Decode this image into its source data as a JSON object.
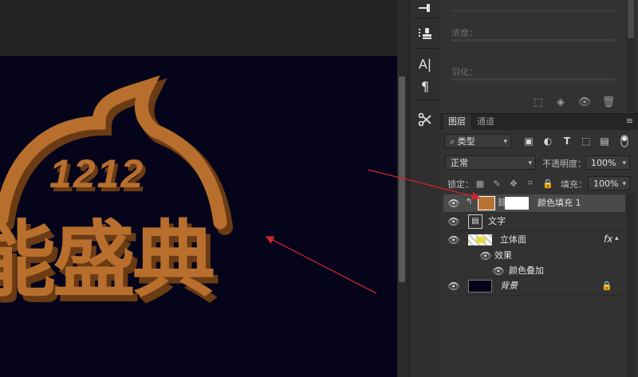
{
  "properties_panel": {
    "density_label": "浓度：",
    "feather_label": "羽化："
  },
  "layers_panel": {
    "tabs": [
      "图层",
      "通道"
    ],
    "menu_icon": "hamburger-icon",
    "filter_kind": "类型",
    "blend_mode": "正常",
    "opacity_label": "不透明度：",
    "opacity_value": "100%",
    "lock_label": "锁定：",
    "fill_label": "填充：",
    "fill_value": "100%",
    "layers": [
      {
        "name": "颜色填充 1",
        "type": "fill",
        "selected": true,
        "color": "#b87333"
      },
      {
        "name": "文字",
        "type": "smart-object"
      },
      {
        "name": "立体面",
        "type": "pixel",
        "fx": "fx"
      },
      {
        "name": "效果",
        "type": "effects-group"
      },
      {
        "name": "颜色叠加",
        "type": "effect"
      },
      {
        "name": "背景",
        "type": "background",
        "locked": true
      }
    ]
  },
  "artwork": {
    "badge_text": "1212",
    "title_text": "能盛典",
    "bronze": "#b86f2e",
    "bronze_shadow": "#6b3b14",
    "background": "#05041a"
  },
  "colors": {
    "annotation_arrow": "#d0232b"
  }
}
